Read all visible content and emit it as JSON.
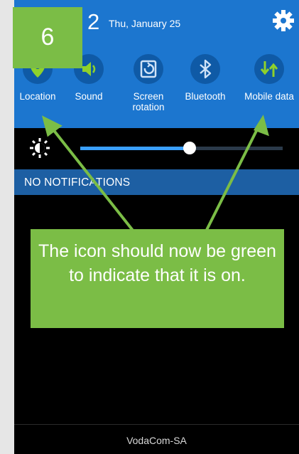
{
  "status_bar": {
    "time": "2",
    "date": "Thu, January 25"
  },
  "quick_settings": [
    {
      "label": "Location",
      "icon": "location-icon"
    },
    {
      "label": "Sound",
      "icon": "sound-icon"
    },
    {
      "label": "Screen rotation",
      "icon": "screen-rotation-icon"
    },
    {
      "label": "Bluetooth",
      "icon": "bluetooth-icon"
    },
    {
      "label": "Mobile data",
      "icon": "mobile-data-icon"
    }
  ],
  "brightness": {
    "level_fraction": 0.54
  },
  "notifications": {
    "header": "NO NOTIFICATIONS"
  },
  "footer": {
    "carrier": "VodaCom-SA"
  },
  "annotation": {
    "step_number": "6",
    "callout_text": "The icon should now be green to indicate that it is on."
  },
  "colors": {
    "panel_blue": "#1c76cf",
    "annotation_green": "#7bbd46",
    "location_icon_green": "#8fd12b",
    "slider_blue": "#3aa0ff"
  }
}
